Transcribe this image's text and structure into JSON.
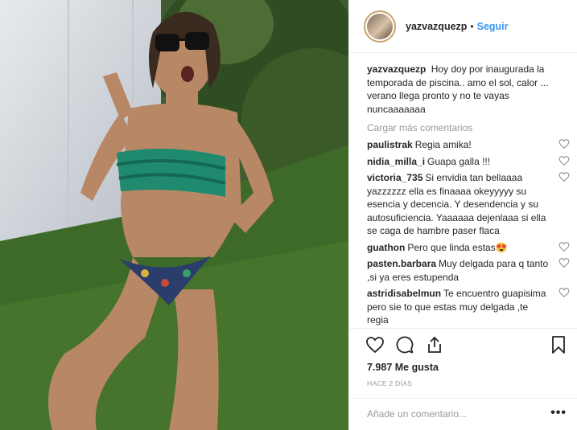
{
  "header": {
    "username": "yazvazquezp",
    "dot": "•",
    "follow_label": "Seguir"
  },
  "caption": {
    "username": "yazvazquezp",
    "text": "Hoy doy por inaugurada la temporada de piscina.. amo el sol, calor ... verano llega pronto y no te vayas nuncaaaaaaa"
  },
  "load_more": "Cargar más comentarios",
  "comments": [
    {
      "user": "paulistrak",
      "text": "Regia amika!"
    },
    {
      "user": "nidia_milla_i",
      "text": "Guapa galla !!!"
    },
    {
      "user": "victoria_735",
      "text": "Si envidia tan bellaaaa yazzzzzz ella es finaaaa okeyyyyy su esencia y decencia. Y desendencia y su autosuficiencia. Yaaaaaa dejenlaaa si ella se caga de hambre paser flaca"
    },
    {
      "user": "guathon",
      "text": "Pero que linda estas😍"
    },
    {
      "user": "pasten.barbara",
      "text": "Muy delgada para q tanto ,si ya eres estupenda"
    },
    {
      "user": "astridisabelmun",
      "text": "Te encuentro guapisima pero sie to que estas muy delgada ,te regia"
    }
  ],
  "actions": {
    "like_icon": "heart-icon",
    "comment_icon": "comment-icon",
    "share_icon": "share-icon",
    "save_icon": "bookmark-icon"
  },
  "likes": "7.987 Me gusta",
  "time": "HACE 2 DÍAS",
  "add_comment": {
    "placeholder": "Añade un comentario...",
    "more": "•••"
  },
  "colors": {
    "link": "#3897f0",
    "muted": "#999999",
    "text": "#262626"
  }
}
